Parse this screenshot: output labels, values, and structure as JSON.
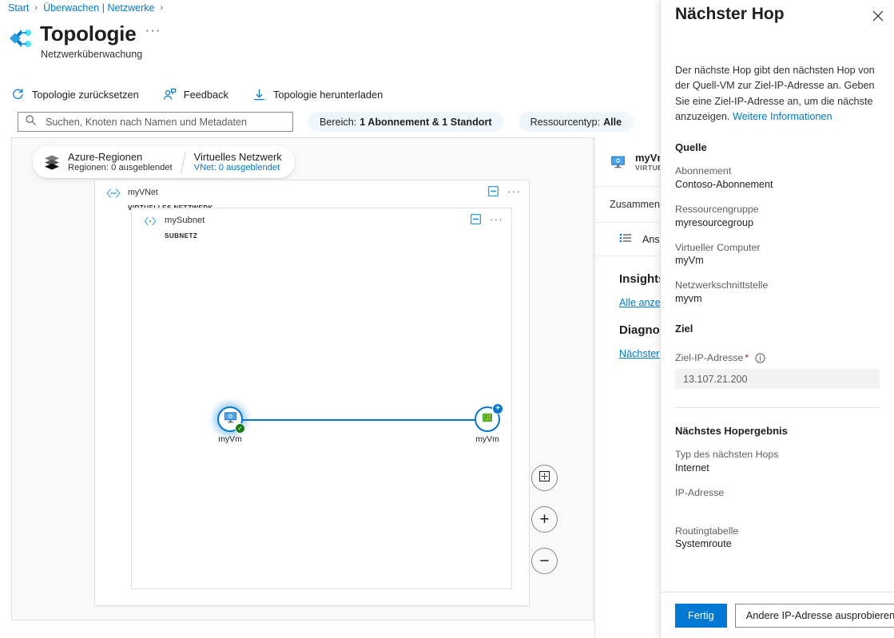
{
  "breadcrumb": {
    "items": [
      "Start",
      "Überwachen | Netzwerke"
    ],
    "separator": "›"
  },
  "header": {
    "title": "Topologie",
    "subtitle": "Netzwerküberwachung",
    "more_label": "···"
  },
  "toolbar": {
    "items": [
      {
        "label": "Topologie zurücksetzen",
        "icon": "refresh-icon"
      },
      {
        "label": "Feedback",
        "icon": "feedback-person-icon"
      },
      {
        "label": "Topologie herunterladen",
        "icon": "download-icon"
      }
    ]
  },
  "filters": {
    "search": {
      "placeholder": "Suchen, Knoten nach Namen und Metadaten",
      "value": ""
    },
    "scope_pill": {
      "prefix": "Bereich:",
      "value": "1 Abonnement & 1 Standort"
    },
    "type_pill": {
      "prefix": "Ressourcentyp:",
      "value": "Alle"
    }
  },
  "canvas": {
    "legend": [
      {
        "title": "Azure-Regionen",
        "subtitle": "Regionen: 0 ausgeblendet",
        "is_link": false
      },
      {
        "title": "Virtuelles Netzwerk",
        "subtitle": "VNet: 0 ausgeblendet",
        "is_link": true
      }
    ],
    "vnet": {
      "name": "myVNet",
      "type": "VIRTUELLES NETZWERK",
      "more_label": "···"
    },
    "subnet": {
      "name": "mySubnet",
      "type": "SUBNETZ",
      "more_label": "···"
    },
    "nodes": [
      {
        "label": "myVm",
        "kind": "virtual-machine",
        "badge": "check"
      },
      {
        "label": "myVm",
        "kind": "network-interface",
        "badge": "plus"
      }
    ],
    "zoom_controls": [
      {
        "name": "fit-to-screen",
        "glyph": ""
      },
      {
        "name": "zoom-in",
        "glyph": "+"
      },
      {
        "name": "zoom-out",
        "glyph": "−"
      }
    ]
  },
  "resource_blade": {
    "name": "myVm",
    "type": "VIRTUELL",
    "tab": "Zusammenfa",
    "view_row": "Ansi",
    "insights_title": "Insights",
    "insights_link": "Alle anzeig",
    "diagnostics_title": "Diagnose",
    "diagnostics_link": "Nächster H"
  },
  "panel": {
    "title": "Nächster Hop",
    "close_label": "✕",
    "description": "Der nächste Hop gibt den nächsten Hop von der Quell-VM zur Ziel-IP-Adresse an. Geben Sie eine Ziel-IP-Adresse an, um die nächste anzuzeigen. ",
    "description_link": "Weitere Informationen",
    "source_heading": "Quelle",
    "source_fields": [
      {
        "key": "Abonnement",
        "value": "Contoso-Abonnement"
      },
      {
        "key": "Ressourcengruppe",
        "value": "myresourcegroup"
      },
      {
        "key": "Virtueller Computer",
        "value": "myVm"
      },
      {
        "key": "Netzwerkschnittstelle",
        "value": "myvm"
      }
    ],
    "target_heading": "Ziel",
    "target_field": {
      "label": "Ziel-IP-Adresse",
      "required_marker": "*",
      "value": "13.107.21.200",
      "placeholder": "Ziel-IP-Adresse"
    },
    "result_heading": "Nächstes Hopergebnis",
    "result_fields": [
      {
        "key": "Typ des nächsten Hops",
        "value": "Internet"
      },
      {
        "key": "IP-Adresse",
        "value": ""
      },
      {
        "key": "Routingtabelle",
        "value": "Systemroute"
      }
    ],
    "footer": {
      "primary": "Fertig",
      "secondary": "Andere IP-Adresse ausprobieren"
    }
  },
  "colors": {
    "accent": "#0078d4",
    "link": "#0078d4",
    "success": "#107c10",
    "required": "#a4262c",
    "canvas_bg": "#faf9f8",
    "pill_bg": "#eff6fc"
  }
}
